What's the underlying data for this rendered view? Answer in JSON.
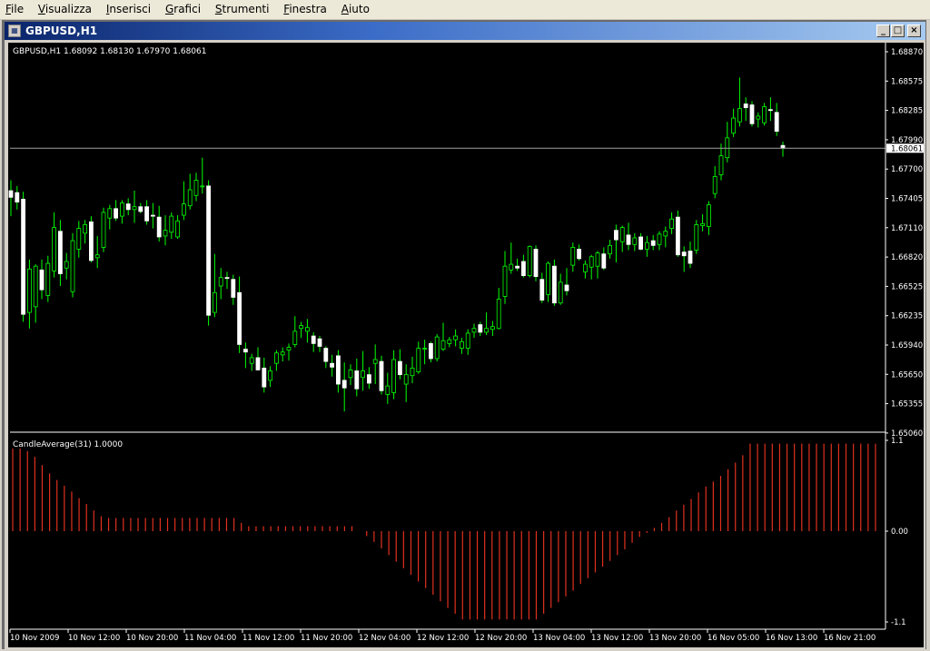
{
  "menu": {
    "items": [
      "File",
      "Visualizza",
      "Inserisci",
      "Grafici",
      "Strumenti",
      "Finestra",
      "Aiuto"
    ]
  },
  "window": {
    "title": "GBPUSD,H1",
    "minimize_label": "_",
    "restore_label": "□",
    "close_label": "×"
  },
  "chart": {
    "info": "GBPUSD,H1  1.68092 1.68130 1.67970 1.68061",
    "bid_label": "1.68061",
    "price_ticks": [
      "1.68870",
      "1.68575",
      "1.68285",
      "1.67990",
      "1.67700",
      "1.67405",
      "1.67110",
      "1.66820",
      "1.66525",
      "1.66235",
      "1.65940",
      "1.65650",
      "1.65355",
      "1.65060"
    ],
    "time_ticks": [
      "10 Nov 2009",
      "10 Nov 12:00",
      "10 Nov 20:00",
      "11 Nov 04:00",
      "11 Nov 12:00",
      "11 Nov 20:00",
      "12 Nov 04:00",
      "12 Nov 12:00",
      "12 Nov 20:00",
      "13 Nov 04:00",
      "13 Nov 12:00",
      "13 Nov 20:00",
      "16 Nov 05:00",
      "16 Nov 13:00",
      "16 Nov 21:00"
    ]
  },
  "indicator": {
    "label": "CandleAverage(31) 1.0000",
    "ticks": [
      "1.1",
      "0.00",
      "-1.1"
    ]
  },
  "colors": {
    "background": "#000000",
    "candle_up": "#00ff00",
    "candle_down": "#ffffff",
    "wick": "#00ff00",
    "histogram": "#e0301e",
    "bid_line": "#a0a0a0",
    "axis_text": "#ffffff"
  },
  "chart_data": [
    {
      "type": "candlestick",
      "title": "GBPUSD,H1",
      "ylim": [
        1.6506,
        1.6916
      ],
      "candles": [
        [
          1.6761,
          1.6772,
          1.6734,
          1.6754
        ],
        [
          1.6759,
          1.6766,
          1.6741,
          1.6749
        ],
        [
          1.6752,
          1.676,
          1.6622,
          1.663
        ],
        [
          1.6632,
          1.6688,
          1.6615,
          1.6678
        ],
        [
          1.6638,
          1.6683,
          1.6621,
          1.6681
        ],
        [
          1.6677,
          1.6688,
          1.6646,
          1.6656
        ],
        [
          1.665,
          1.6692,
          1.6643,
          1.6684
        ],
        [
          1.6676,
          1.6738,
          1.6669,
          1.6722
        ],
        [
          1.6718,
          1.673,
          1.666,
          1.6673
        ],
        [
          1.6679,
          1.6695,
          1.6667,
          1.6686
        ],
        [
          1.6654,
          1.6716,
          1.6648,
          1.6708
        ],
        [
          1.6699,
          1.6729,
          1.669,
          1.6721
        ],
        [
          1.6716,
          1.673,
          1.6705,
          1.6725
        ],
        [
          1.6728,
          1.6734,
          1.6685,
          1.6687
        ],
        [
          1.669,
          1.6713,
          1.6679,
          1.6693
        ],
        [
          1.6701,
          1.6743,
          1.6696,
          1.6738
        ],
        [
          1.6732,
          1.6746,
          1.672,
          1.6742
        ],
        [
          1.6742,
          1.6751,
          1.6729,
          1.6732
        ],
        [
          1.6734,
          1.6751,
          1.6726,
          1.6748
        ],
        [
          1.6747,
          1.6753,
          1.6735,
          1.6741
        ],
        [
          1.6741,
          1.6761,
          1.6727,
          1.6744
        ],
        [
          1.6744,
          1.6748,
          1.6737,
          1.6739
        ],
        [
          1.6744,
          1.6751,
          1.6725,
          1.6729
        ],
        [
          1.6735,
          1.6748,
          1.6721,
          1.6734
        ],
        [
          1.6733,
          1.6745,
          1.6707,
          1.6712
        ],
        [
          1.6713,
          1.6735,
          1.6703,
          1.6719
        ],
        [
          1.6717,
          1.6738,
          1.671,
          1.6734
        ],
        [
          1.6712,
          1.6735,
          1.671,
          1.6729
        ],
        [
          1.6735,
          1.6771,
          1.673,
          1.6747
        ],
        [
          1.6745,
          1.6779,
          1.6741,
          1.6762
        ],
        [
          1.6756,
          1.678,
          1.675,
          1.6772
        ],
        [
          1.6766,
          1.6796,
          1.6758,
          1.6766
        ],
        [
          1.6766,
          1.6772,
          1.6618,
          1.6629
        ],
        [
          1.6632,
          1.6694,
          1.6627,
          1.6653
        ],
        [
          1.666,
          1.6679,
          1.6646,
          1.6669
        ],
        [
          1.6669,
          1.6675,
          1.6657,
          1.6668
        ],
        [
          1.6667,
          1.6672,
          1.664,
          1.6648
        ],
        [
          1.6653,
          1.667,
          1.6589,
          1.6598
        ],
        [
          1.6593,
          1.66,
          1.6573,
          1.659
        ],
        [
          1.6578,
          1.6588,
          1.657,
          1.6584
        ],
        [
          1.6584,
          1.6595,
          1.6571,
          1.6571
        ],
        [
          1.6573,
          1.6584,
          1.6547,
          1.6553
        ],
        [
          1.656,
          1.6575,
          1.6553,
          1.657
        ],
        [
          1.6578,
          1.6592,
          1.657,
          1.6589
        ],
        [
          1.6587,
          1.6595,
          1.658,
          1.659
        ],
        [
          1.6592,
          1.6599,
          1.6581,
          1.6595
        ],
        [
          1.6598,
          1.6628,
          1.6595,
          1.6612
        ],
        [
          1.6615,
          1.6622,
          1.6605,
          1.6618
        ],
        [
          1.6612,
          1.6625,
          1.66,
          1.6616
        ],
        [
          1.6607,
          1.6611,
          1.659,
          1.6599
        ],
        [
          1.6604,
          1.6607,
          1.659,
          1.6596
        ],
        [
          1.6594,
          1.6596,
          1.6573,
          1.658
        ],
        [
          1.6578,
          1.6587,
          1.6564,
          1.6574
        ],
        [
          1.6586,
          1.6592,
          1.6547,
          1.6556
        ],
        [
          1.656,
          1.6579,
          1.6527,
          1.6552
        ],
        [
          1.6563,
          1.6577,
          1.6555,
          1.6571
        ],
        [
          1.657,
          1.6583,
          1.6543,
          1.6551
        ],
        [
          1.6563,
          1.6591,
          1.6549,
          1.657
        ],
        [
          1.6566,
          1.6574,
          1.6551,
          1.6557
        ],
        [
          1.6578,
          1.6598,
          1.6556,
          1.6582
        ],
        [
          1.658,
          1.6586,
          1.6545,
          1.6549
        ],
        [
          1.6545,
          1.6568,
          1.6535,
          1.6554
        ],
        [
          1.6547,
          1.6592,
          1.654,
          1.6582
        ],
        [
          1.658,
          1.6593,
          1.6561,
          1.6566
        ],
        [
          1.6556,
          1.6577,
          1.6537,
          1.6566
        ],
        [
          1.6565,
          1.6585,
          1.6557,
          1.6573
        ],
        [
          1.6569,
          1.6601,
          1.6567,
          1.6594
        ],
        [
          1.6594,
          1.6603,
          1.6577,
          1.6594
        ],
        [
          1.6599,
          1.6601,
          1.6579,
          1.6583
        ],
        [
          1.6583,
          1.6609,
          1.658,
          1.6606
        ],
        [
          1.6593,
          1.6621,
          1.6591,
          1.6602
        ],
        [
          1.6599,
          1.6606,
          1.6595,
          1.6603
        ],
        [
          1.6603,
          1.6614,
          1.6596,
          1.6607
        ],
        [
          1.6594,
          1.6605,
          1.6588,
          1.6601
        ],
        [
          1.6594,
          1.6614,
          1.6587,
          1.661
        ],
        [
          1.6611,
          1.662,
          1.6605,
          1.6615
        ],
        [
          1.6619,
          1.6622,
          1.6607,
          1.6611
        ],
        [
          1.6611,
          1.6632,
          1.6608,
          1.6615
        ],
        [
          1.6614,
          1.6623,
          1.6607,
          1.6617
        ],
        [
          1.6615,
          1.6658,
          1.6614,
          1.6646
        ],
        [
          1.6649,
          1.6697,
          1.6641,
          1.6681
        ],
        [
          1.6677,
          1.6706,
          1.6673,
          1.6683
        ],
        [
          1.6681,
          1.6689,
          1.6676,
          1.6679
        ],
        [
          1.6686,
          1.6693,
          1.6669,
          1.6671
        ],
        [
          1.6671,
          1.6703,
          1.6669,
          1.6702
        ],
        [
          1.6699,
          1.6703,
          1.6665,
          1.667
        ],
        [
          1.6667,
          1.6674,
          1.6642,
          1.6645
        ],
        [
          1.6651,
          1.6686,
          1.6643,
          1.6684
        ],
        [
          1.6681,
          1.6688,
          1.6639,
          1.6642
        ],
        [
          1.6642,
          1.6673,
          1.664,
          1.6664
        ],
        [
          1.6661,
          1.6679,
          1.665,
          1.6655
        ],
        [
          1.6682,
          1.6706,
          1.6675,
          1.6701
        ],
        [
          1.6699,
          1.6704,
          1.6687,
          1.6689
        ],
        [
          1.6675,
          1.6687,
          1.6668,
          1.6683
        ],
        [
          1.668,
          1.6693,
          1.6667,
          1.6691
        ],
        [
          1.6681,
          1.6697,
          1.6668,
          1.6695
        ],
        [
          1.6694,
          1.6701,
          1.6677,
          1.6679
        ],
        [
          1.6694,
          1.6709,
          1.6689,
          1.6703
        ],
        [
          1.6719,
          1.6725,
          1.6685,
          1.6709
        ],
        [
          1.6707,
          1.6724,
          1.6696,
          1.6722
        ],
        [
          1.6714,
          1.6727,
          1.6698,
          1.6704
        ],
        [
          1.6704,
          1.6716,
          1.6697,
          1.6711
        ],
        [
          1.6712,
          1.6716,
          1.6698,
          1.6699
        ],
        [
          1.6699,
          1.6713,
          1.6691,
          1.6706
        ],
        [
          1.6708,
          1.6714,
          1.6698,
          1.6703
        ],
        [
          1.6704,
          1.6718,
          1.6698,
          1.6715
        ],
        [
          1.6713,
          1.6723,
          1.6701,
          1.6718
        ],
        [
          1.6721,
          1.6738,
          1.6715,
          1.6731
        ],
        [
          1.6733,
          1.674,
          1.6691,
          1.6693
        ],
        [
          1.6696,
          1.6702,
          1.6675,
          1.6692
        ],
        [
          1.6697,
          1.6707,
          1.6679,
          1.6684
        ],
        [
          1.6698,
          1.673,
          1.6694,
          1.6725
        ],
        [
          1.6724,
          1.6736,
          1.6718,
          1.6726
        ],
        [
          1.6723,
          1.675,
          1.6714,
          1.6746
        ],
        [
          1.6758,
          1.6787,
          1.6753,
          1.6776
        ],
        [
          1.6778,
          1.6811,
          1.6772,
          1.6798
        ],
        [
          1.6796,
          1.6834,
          1.6791,
          1.6817
        ],
        [
          1.6822,
          1.6848,
          1.6818,
          1.6838
        ],
        [
          1.6834,
          1.6881,
          1.6829,
          1.6848
        ],
        [
          1.6853,
          1.686,
          1.6835,
          1.6849
        ],
        [
          1.6852,
          1.6856,
          1.6829,
          1.6832
        ],
        [
          1.6837,
          1.6844,
          1.6828,
          1.684
        ],
        [
          1.6833,
          1.6854,
          1.683,
          1.685
        ],
        [
          1.6847,
          1.686,
          1.6835,
          1.6846
        ],
        [
          1.6844,
          1.6854,
          1.6819,
          1.6824
        ],
        [
          1.6809,
          1.6813,
          1.6797,
          1.6806
        ]
      ]
    },
    {
      "type": "bar",
      "title": "CandleAverage(31) 1.0000",
      "ylim": [
        -1.1,
        1.1
      ],
      "values": [
        1.0,
        1.0,
        0.97,
        0.9,
        0.8,
        0.7,
        0.62,
        0.55,
        0.48,
        0.4,
        0.33,
        0.25,
        0.18,
        0.16,
        0.16,
        0.16,
        0.16,
        0.16,
        0.16,
        0.16,
        0.16,
        0.16,
        0.16,
        0.16,
        0.16,
        0.16,
        0.16,
        0.16,
        0.16,
        0.16,
        0.16,
        0.1,
        0.06,
        0.06,
        0.06,
        0.06,
        0.06,
        0.06,
        0.06,
        0.06,
        0.06,
        0.06,
        0.06,
        0.06,
        0.06,
        0.06,
        0.06,
        0.0,
        -0.06,
        -0.13,
        -0.21,
        -0.29,
        -0.37,
        -0.45,
        -0.53,
        -0.61,
        -0.69,
        -0.77,
        -0.85,
        -0.93,
        -1.0,
        -1.07,
        -1.07,
        -1.07,
        -1.07,
        -1.07,
        -1.07,
        -1.07,
        -1.07,
        -1.07,
        -1.07,
        -1.07,
        -1.0,
        -0.93,
        -0.86,
        -0.79,
        -0.72,
        -0.64,
        -0.57,
        -0.5,
        -0.43,
        -0.36,
        -0.29,
        -0.22,
        -0.14,
        -0.07,
        -0.02,
        0.04,
        0.1,
        0.17,
        0.25,
        0.32,
        0.39,
        0.47,
        0.54,
        0.6,
        0.67,
        0.75,
        0.83,
        0.92,
        1.06,
        1.06,
        1.06,
        1.06,
        1.06,
        1.06,
        1.06,
        1.06,
        1.06,
        1.06,
        1.06,
        1.06,
        1.06,
        1.06,
        1.06,
        1.06,
        1.06,
        1.06
      ]
    }
  ]
}
